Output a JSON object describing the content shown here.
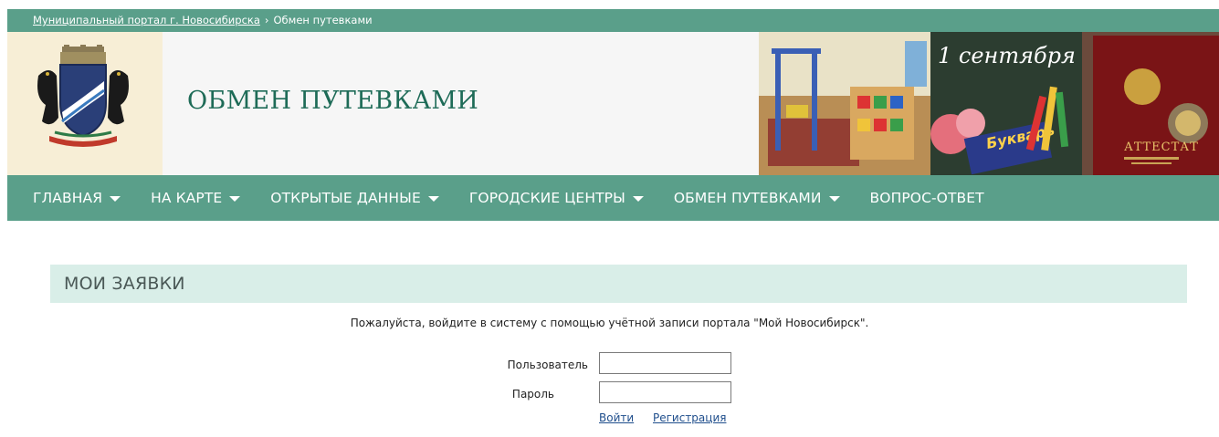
{
  "breadcrumb": {
    "portal_link": "Муниципальный портал г. Новосибирска",
    "separator": "›",
    "current": "Обмен путевками"
  },
  "header": {
    "title": "ОБМЕН ПУТЕВКАМИ",
    "banner_texts": {
      "date": "1 сентября",
      "book": "Букварь",
      "certificate": "АТТЕСТАТ"
    }
  },
  "nav": {
    "items": [
      {
        "label": "ГЛАВНАЯ",
        "dropdown": true
      },
      {
        "label": "НА КАРТЕ",
        "dropdown": true
      },
      {
        "label": "ОТКРЫТЫЕ ДАННЫЕ",
        "dropdown": true
      },
      {
        "label": "ГОРОДСКИЕ ЦЕНТРЫ",
        "dropdown": true
      },
      {
        "label": "ОБМЕН ПУТЕВКАМИ",
        "dropdown": true
      },
      {
        "label": "ВОПРОС-ОТВЕТ",
        "dropdown": false
      }
    ]
  },
  "main": {
    "panel_title": "МОИ ЗАЯВКИ",
    "login_note": "Пожалуйста, войдите в систему с помощью учётной записи портала \"Мой Новосибирск\".",
    "form": {
      "username_label": "Пользователь",
      "password_label": "Пароль",
      "username_value": "",
      "password_value": "",
      "login_link": "Войти",
      "register_link": "Регистрация"
    }
  },
  "colors": {
    "nav_green": "#5a9f8a",
    "title_green": "#1e6b57",
    "panel_bg": "#d9eee8",
    "logo_bg": "#f7eed6",
    "link_blue": "#1f4e8c"
  }
}
